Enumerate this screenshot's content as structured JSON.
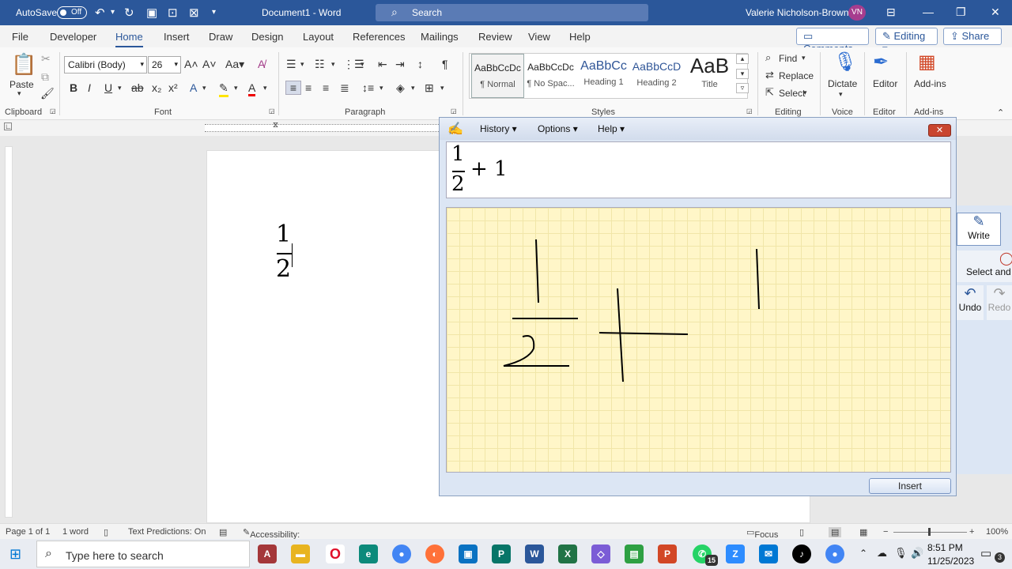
{
  "titlebar": {
    "autosave_label": "AutoSave",
    "autosave_state": "Off",
    "doc_title": "Document1  -  Word",
    "search_placeholder": "Search",
    "user_name": "Valerie Nicholson-Brown",
    "user_initials": "VN"
  },
  "tabs": [
    "File",
    "Developer",
    "Home",
    "Insert",
    "Draw",
    "Design",
    "Layout",
    "References",
    "Mailings",
    "Review",
    "View",
    "Help"
  ],
  "active_tab": "Home",
  "ribbon_right": {
    "comments": "Comments",
    "editing": "Editing",
    "share": "Share"
  },
  "font": {
    "name": "Calibri (Body)",
    "size": "26"
  },
  "clipboard": {
    "paste": "Paste"
  },
  "styles": [
    {
      "preview": "AaBbCcDc",
      "name": "¶ Normal"
    },
    {
      "preview": "AaBbCcDc",
      "name": "¶ No Spac..."
    },
    {
      "preview": "AaBbCc",
      "name": "Heading 1"
    },
    {
      "preview": "AaBbCcD",
      "name": "Heading 2"
    },
    {
      "preview": "AaB",
      "name": "Title"
    }
  ],
  "editing_grp": {
    "find": "Find",
    "replace": "Replace",
    "select": "Select"
  },
  "voice": {
    "dictate": "Dictate"
  },
  "editor": {
    "label": "Editor"
  },
  "addins": {
    "label": "Add-ins"
  },
  "groups": {
    "clipboard": "Clipboard",
    "font": "Font",
    "paragraph": "Paragraph",
    "styles": "Styles",
    "editing": "Editing",
    "voice": "Voice",
    "editor": "Editor",
    "addins": "Add-ins"
  },
  "document": {
    "numerator": "1",
    "denominator": "2"
  },
  "math_panel": {
    "menu": [
      "History",
      "Options",
      "Help"
    ],
    "preview_num": "1",
    "preview_den": "2",
    "preview_rest": "+ 1",
    "insert": "Insert",
    "tools": {
      "write": "Write",
      "select": "Select and C",
      "undo": "Undo",
      "redo": "Redo"
    }
  },
  "status": {
    "page": "Page 1 of 1",
    "words": "1 word",
    "predictions": "Text Predictions: On",
    "accessibility": "Accessibility: Good to go",
    "focus": "Focus",
    "zoom": "100%"
  },
  "taskbar": {
    "search_placeholder": "Type here to search",
    "time": "8:51 PM",
    "date": "11/25/2023",
    "whatsapp_badge": "15",
    "notif_count": "3"
  }
}
